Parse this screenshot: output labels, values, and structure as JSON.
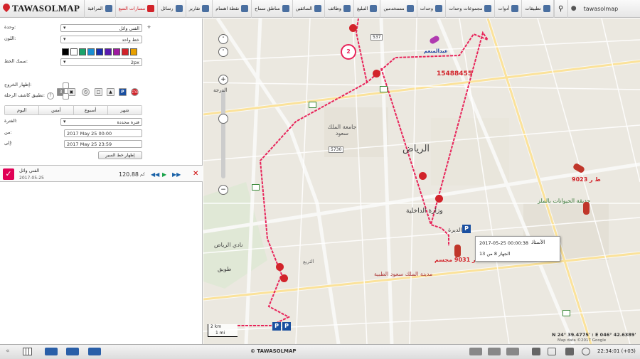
{
  "topbar": {
    "logo_text": "TAWASOLMAP",
    "username": "tawasolmap",
    "items": [
      {
        "id": "monitoring",
        "label": "المراقبة"
      },
      {
        "id": "tracking",
        "label": "مسارات التتبع"
      },
      {
        "id": "messages",
        "label": "رسائل"
      },
      {
        "id": "reports",
        "label": "تقارير"
      },
      {
        "id": "poi",
        "label": "نقطة اهتمام"
      },
      {
        "id": "geofences",
        "label": "مناطق سماح"
      },
      {
        "id": "drivers",
        "label": "السائقين"
      },
      {
        "id": "jobs",
        "label": "وظائف"
      },
      {
        "id": "notifications",
        "label": "التبليغ"
      },
      {
        "id": "users",
        "label": "مستخدمين"
      },
      {
        "id": "units",
        "label": "وحدات"
      },
      {
        "id": "unit-groups",
        "label": "مجموعات وحدات"
      },
      {
        "id": "tools",
        "label": "أدوات"
      },
      {
        "id": "apps",
        "label": "تطبيقات"
      }
    ]
  },
  "panel": {
    "unit_label": "وحدة:",
    "unit_value": "الفني وائل",
    "color_label": "اللون:",
    "color_value": "خط واحد",
    "colors": [
      "#000000",
      "#ffffff",
      "#1aa36a",
      "#1a8fd2",
      "#1a2fb0",
      "#5a1ab0",
      "#a01aa0",
      "#d2232a",
      "#e8a000"
    ],
    "thickness_label": "سمك الخط:",
    "thickness_value": "2px",
    "show_exit_label": "إظهار الخروج:",
    "apply_trip_label": "تطبيق كاشف الرحلة:",
    "tabs": [
      "اليوم",
      "أمس",
      "أسبوع",
      "شهر"
    ],
    "period_label": "الفترة:",
    "period_value": "فترة محددة",
    "from_label": "من:",
    "from_value": "2017 May 25 00:00",
    "to_label": "إلى:",
    "to_value": "2017 May 25 23:59",
    "show_btn": "إظهار خط السير",
    "trip": {
      "name": "الفني وائل",
      "date": "2017-05-25",
      "distance": "120.88",
      "unit": "كم"
    }
  },
  "map": {
    "cluster_count": "2",
    "unit_label_1": "15488455",
    "unit_label_2": "ط ر 9023",
    "unit_label_3": "ط ر 9031 مجسم",
    "unit_label_4": "عبدالمنعم",
    "city_label": "الرياض",
    "label_university": "جامعة الملك سعود",
    "label_interior": "وزارة الداخلية",
    "label_zoo": "حديقة الحيوانات بالملز",
    "label_hospital": "مدينة الملك سعود الطبية",
    "label_club": "نادي الرياض",
    "label_ruby": "طويق",
    "label_dirah": "الديرة",
    "label_bureau": "التريع",
    "popup_title": "الأستاذ",
    "popup_date": "2017-05-25 00:00:38",
    "popup_detail": "13 الجهاز 8 من",
    "road_537": "537",
    "road_5730": "5730",
    "scale_km": "2 km",
    "scale_mi": "1 mi",
    "coords": "N 24° 39.4775' : E 046° 42.6389'",
    "map_data": "Map data ©2017 Google",
    "zoom_label": "الدرجة"
  },
  "bottombar": {
    "copyright": "© TAWASOLMAP",
    "clock": "22:34:01 (+03)"
  }
}
